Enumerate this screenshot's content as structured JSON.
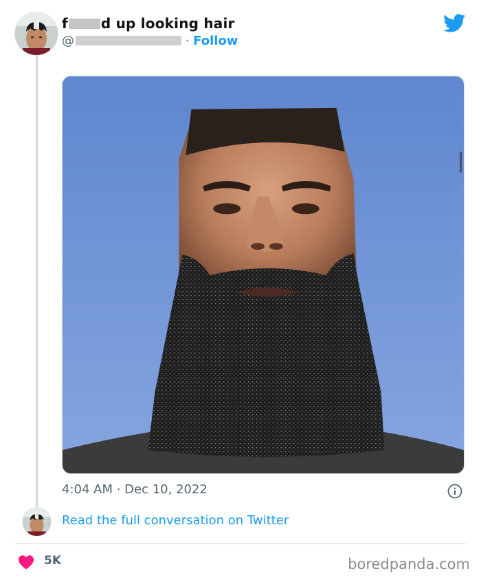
{
  "tweet": {
    "display_name_prefix": "f",
    "display_name_suffix": "d up looking hair",
    "handle_prefix": "@",
    "separator": " · ",
    "follow_label": "Follow",
    "time": "4:04 AM",
    "date_separator": " · ",
    "date": "Dec 10, 2022",
    "read_conversation": "Read the full conversation on Twitter",
    "likes": "5K"
  },
  "watermark": "boredpanda.com",
  "icons": {
    "brand": "twitter-bird-icon",
    "info": "info-icon",
    "like": "heart-icon"
  },
  "colors": {
    "accent": "#1d9bf0",
    "heart": "#f91880",
    "muted": "#536471",
    "sky": "#6d8fd2"
  }
}
